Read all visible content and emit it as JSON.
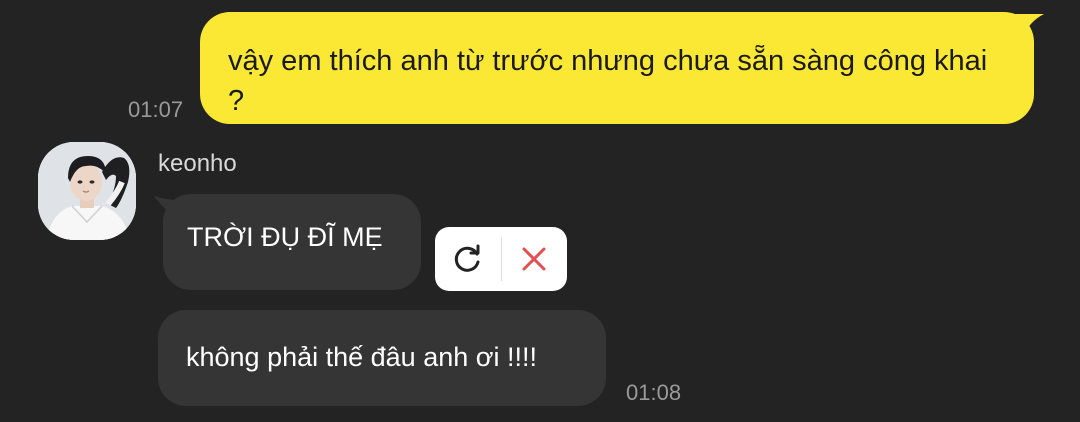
{
  "outgoing": {
    "text": "vậy em thích anh từ trước nhưng chưa sẵn sàng công khai ?",
    "time": "01:07",
    "bubble_color": "#fbe835"
  },
  "incoming": {
    "sender": "keonho",
    "avatar_icon": "user-avatar",
    "messages": [
      {
        "text": "TRỜI ĐỤ ĐĨ MẸ",
        "status": "failed"
      },
      {
        "text": "không phải thế đâu anh ơi !!!!",
        "time": "01:08"
      }
    ],
    "bubble_color": "#353535"
  },
  "failed_actions": {
    "retry_icon": "retry-icon",
    "delete_icon": "close-icon",
    "delete_color": "#e05050"
  },
  "theme": {
    "background": "#232323"
  }
}
